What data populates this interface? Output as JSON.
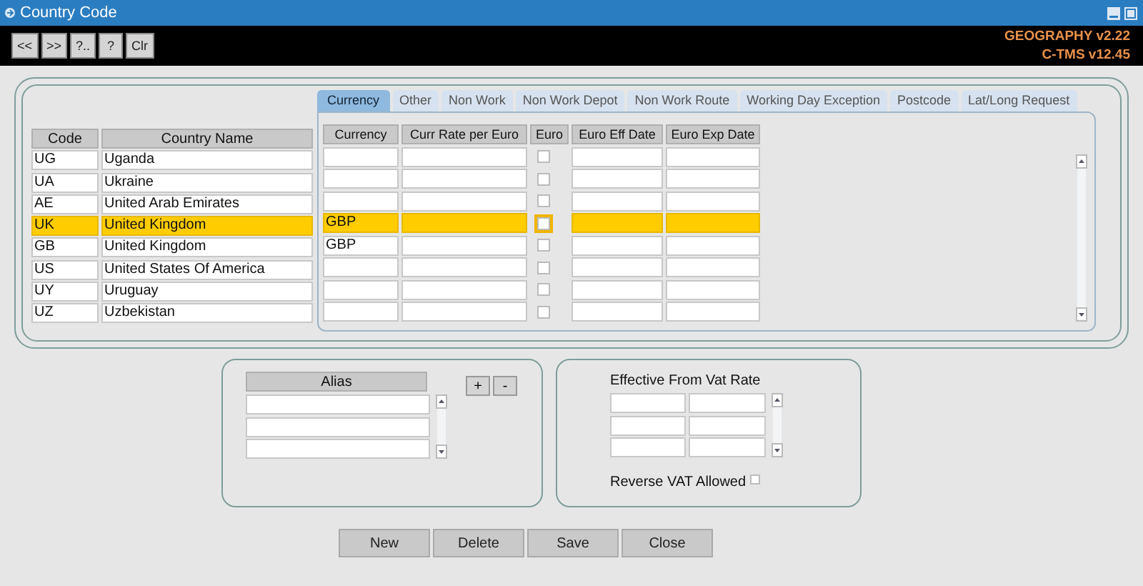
{
  "window": {
    "title": "Country Code"
  },
  "toolbar": {
    "buttons": [
      "<<",
      ">>",
      "?..",
      "?",
      "Clr"
    ],
    "versions": [
      "GEOGRAPHY v2.22",
      "C-TMS v12.45"
    ]
  },
  "countries": {
    "columns": [
      "Code",
      "Country Name"
    ],
    "rows": [
      {
        "code": "UG",
        "name": "Uganda",
        "selected": false
      },
      {
        "code": "UA",
        "name": "Ukraine",
        "selected": false
      },
      {
        "code": "AE",
        "name": "United Arab Emirates",
        "selected": false
      },
      {
        "code": "UK",
        "name": "United Kingdom",
        "selected": true
      },
      {
        "code": "GB",
        "name": "United Kingdom",
        "selected": false
      },
      {
        "code": "US",
        "name": "United States Of America",
        "selected": false
      },
      {
        "code": "UY",
        "name": "Uruguay",
        "selected": false
      },
      {
        "code": "UZ",
        "name": "Uzbekistan",
        "selected": false
      }
    ]
  },
  "tabs": [
    {
      "label": "Currency",
      "selected": true
    },
    {
      "label": "Other",
      "selected": false
    },
    {
      "label": "Non Work",
      "selected": false
    },
    {
      "label": "Non Work Depot",
      "selected": false
    },
    {
      "label": "Non Work Route",
      "selected": false
    },
    {
      "label": "Working Day Exception",
      "selected": false
    },
    {
      "label": "Postcode",
      "selected": false
    },
    {
      "label": "Lat/Long Request",
      "selected": false
    }
  ],
  "currency_table": {
    "columns": [
      "Currency",
      "Curr Rate per Euro",
      "Euro",
      "Euro Eff Date",
      "Euro Exp Date"
    ],
    "rows": [
      {
        "euro": false,
        "selected": false
      },
      {
        "euro": false,
        "selected": false
      },
      {
        "euro": false,
        "selected": false
      },
      {
        "currency": "GBP",
        "euro": false,
        "selected": true
      },
      {
        "currency": "GBP",
        "euro": false,
        "selected": false
      },
      {
        "euro": false,
        "selected": false
      },
      {
        "euro": false,
        "selected": false
      },
      {
        "euro": false,
        "selected": false
      }
    ]
  },
  "alias": {
    "header": "Alias",
    "buttons": [
      "+",
      "-"
    ]
  },
  "vat": {
    "header": "Effective From Vat Rate",
    "reverse_label": "Reverse VAT Allowed",
    "reverse_checked": false
  },
  "buttons": [
    "New",
    "Delete",
    "Save",
    "Close"
  ]
}
